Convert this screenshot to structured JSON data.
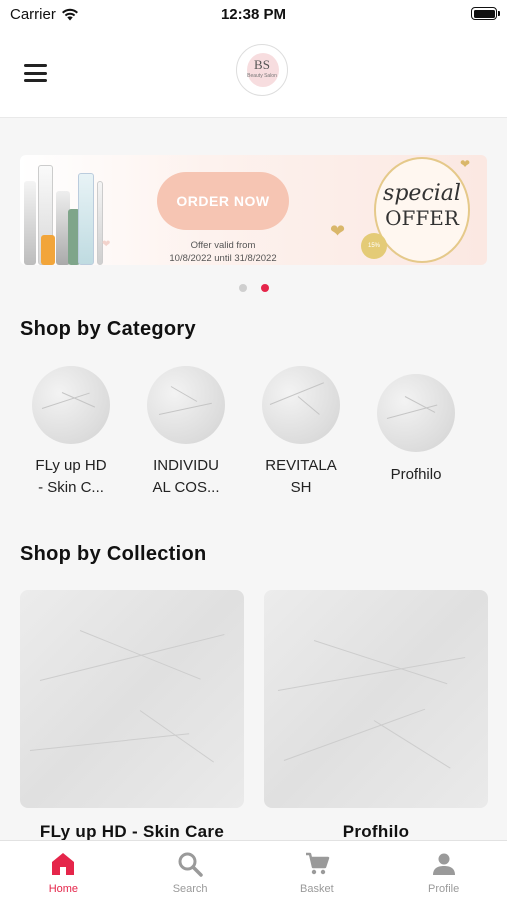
{
  "status_bar": {
    "carrier": "Carrier",
    "time": "12:38 PM"
  },
  "header": {
    "logo_monogram": "BS",
    "logo_tagline": "Beauty Salon"
  },
  "banner": {
    "cta_label": "ORDER NOW",
    "offer_valid_line1": "Offer valid  from",
    "offer_valid_line2": "10/8/2022 until 31/8/2022",
    "special": "special",
    "offer": "OFFER",
    "discount": "15%",
    "slides": 2,
    "active_slide": 2
  },
  "categories": {
    "title": "Shop by Category",
    "items": [
      {
        "label_line1": "FLy up HD",
        "label_line2": "- Skin C..."
      },
      {
        "label_line1": "INDIVIDU",
        "label_line2": "AL COS..."
      },
      {
        "label_line1": "REVITALA",
        "label_line2": "SH"
      },
      {
        "label_line1": "Profhilo",
        "label_line2": ""
      }
    ]
  },
  "collections": {
    "title": "Shop by Collection",
    "items": [
      {
        "label": "FLy up HD - Skin Care"
      },
      {
        "label": "Profhilo"
      }
    ]
  },
  "tabbar": {
    "items": [
      {
        "label": "Home",
        "icon": "home-icon",
        "active": true
      },
      {
        "label": "Search",
        "icon": "search-icon",
        "active": false
      },
      {
        "label": "Basket",
        "icon": "cart-icon",
        "active": false
      },
      {
        "label": "Profile",
        "icon": "person-icon",
        "active": false
      }
    ]
  },
  "colors": {
    "accent": "#e5254a",
    "inactive": "#9a9a9a",
    "cta": "#f6c5b3"
  }
}
